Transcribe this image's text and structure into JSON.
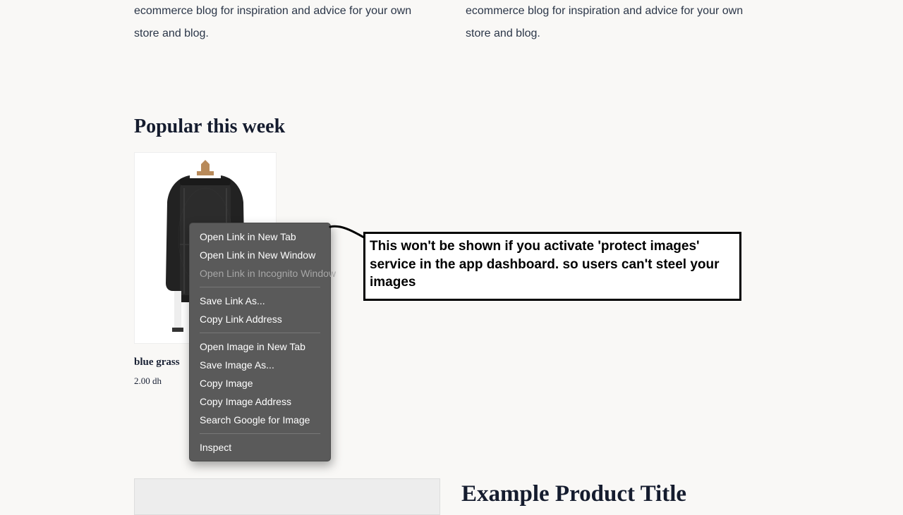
{
  "blurbs": {
    "left": "ecommerce blog for inspiration and advice for your own store and blog.",
    "right": "ecommerce blog for inspiration and advice for your own store and blog."
  },
  "section_heading": "Popular this week",
  "product": {
    "title": "blue grass",
    "price": "2.00 dh"
  },
  "context_menu": {
    "open_tab": "Open Link in New Tab",
    "open_window": "Open Link in New Window",
    "open_incognito": "Open Link in Incognito Window",
    "save_link": "Save Link As...",
    "copy_link": "Copy Link Address",
    "open_image": "Open Image in New Tab",
    "save_image": "Save Image As...",
    "copy_image": "Copy Image",
    "copy_image_addr": "Copy Image Address",
    "search_google": "Search Google for Image",
    "inspect": "Inspect"
  },
  "callout": "This won't be shown if you activate 'protect images' service in the app dashboard. so users can't steel your images",
  "example_title": "Example Product Title"
}
